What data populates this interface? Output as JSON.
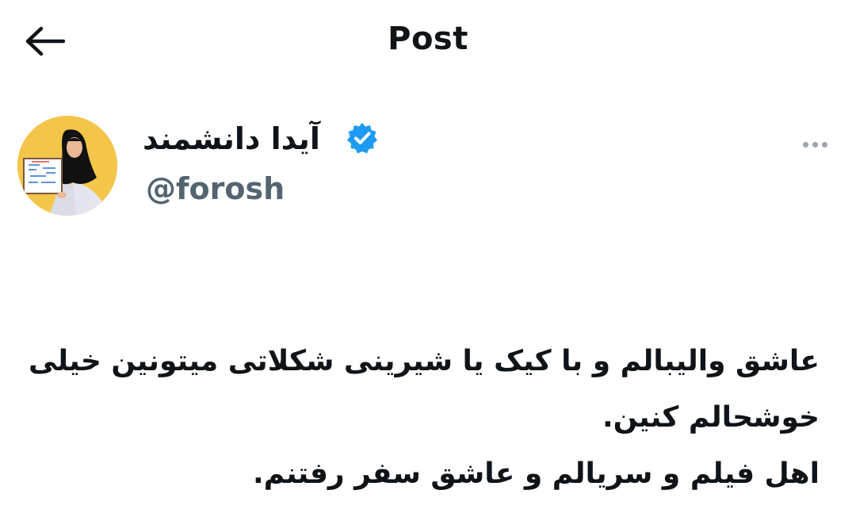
{
  "header": {
    "title": "Post",
    "back_icon": "arrow-left-icon"
  },
  "author": {
    "name": "آیدا دانشمند",
    "handle": "@forosh",
    "verified_icon": "verified-badge-icon",
    "verified_color": "#1d9bf0",
    "avatar_background": "#f3c64a"
  },
  "more_icon": "more-horizontal-icon",
  "post": {
    "lines": [
      "عاشق والیبالم و با کیک یا شیرینی شکلاتی میتونین خیلی",
      "خوشحالم کنین.",
      "اهل فیلم و سریالم و عاشق سفر رفتنم."
    ]
  },
  "colors": {
    "text_primary": "#0f1419",
    "text_secondary": "#536471"
  }
}
